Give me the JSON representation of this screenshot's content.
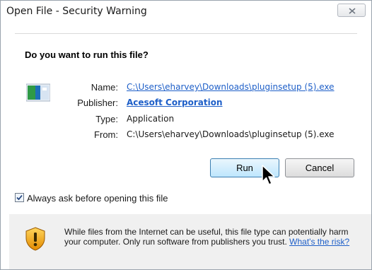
{
  "window": {
    "title": "Open File - Security Warning"
  },
  "dialog": {
    "question": "Do you want to run this file?",
    "file_icon": "installer-file-icon",
    "labels": {
      "name": "Name:",
      "publisher": "Publisher:",
      "type": "Type:",
      "from": "From:"
    },
    "values": {
      "name": "C:\\Users\\eharvey\\Downloads\\pluginsetup (5).exe",
      "publisher": "Acesoft Corporation",
      "type": "Application",
      "from": "C:\\Users\\eharvey\\Downloads\\pluginsetup (5).exe"
    }
  },
  "buttons": {
    "run": "Run",
    "cancel": "Cancel"
  },
  "checkbox": {
    "label": "Always ask before opening this file",
    "checked": true
  },
  "warning": {
    "icon": "shield-warning-icon",
    "text": "While files from the Internet can be useful, this file type can potentially harm your computer. Only run software from publishers you trust.",
    "link": "What's the risk?"
  },
  "colors": {
    "link": "#1e5fc8",
    "warning_background": "#f0f0f0"
  }
}
